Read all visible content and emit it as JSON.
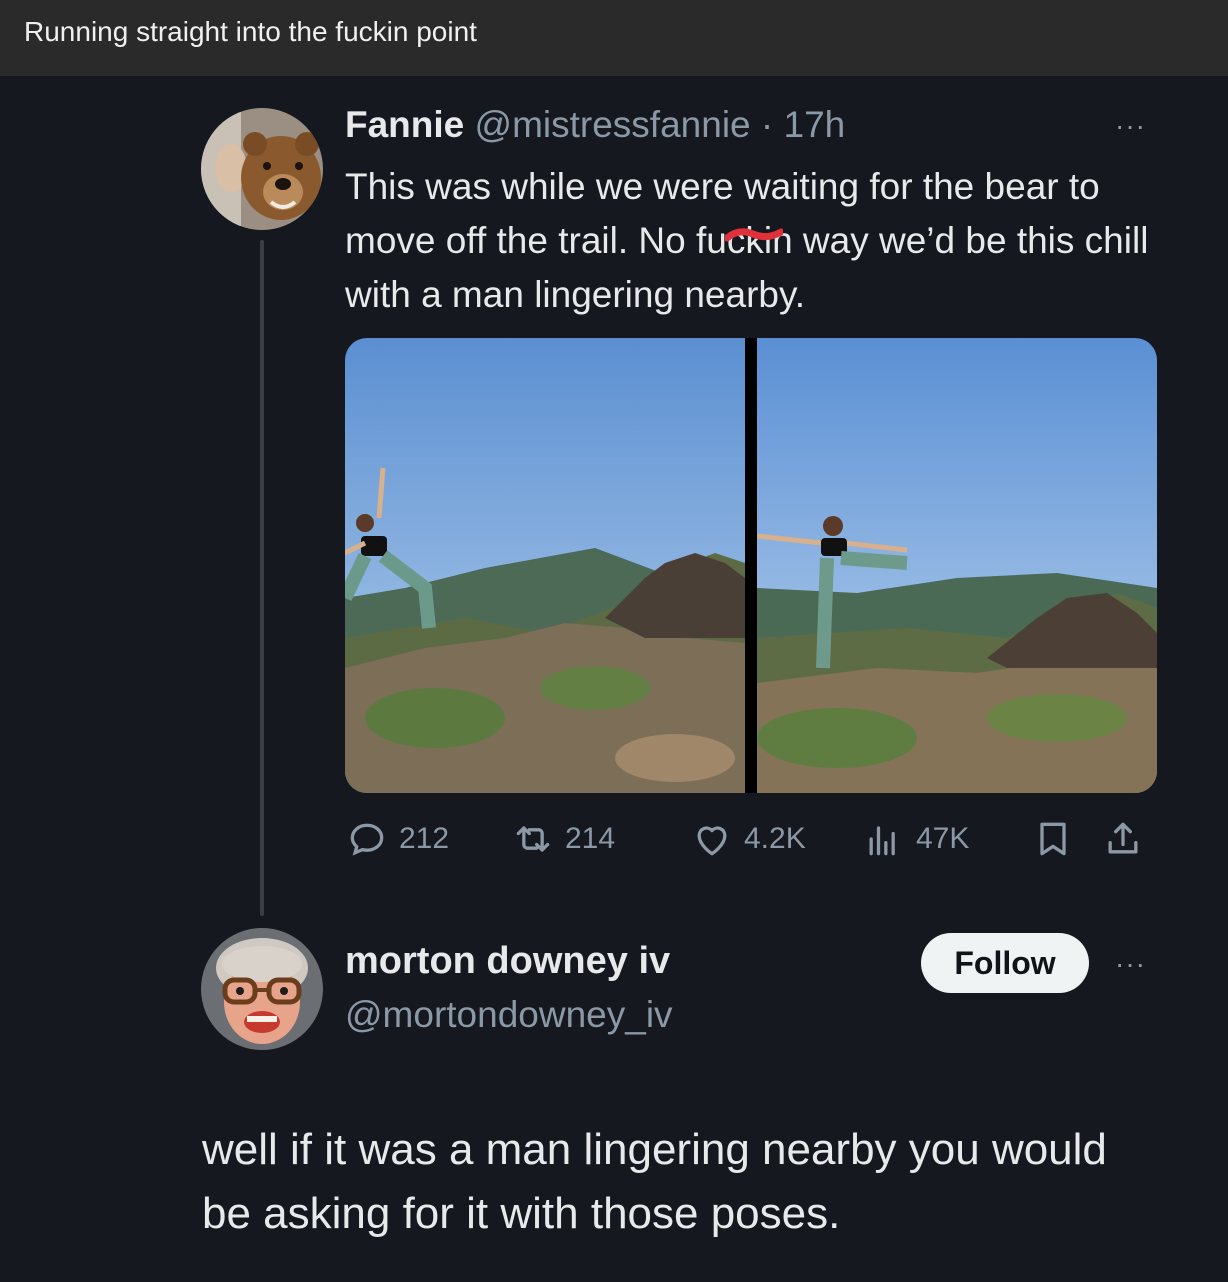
{
  "caption": "Running straight into the fuckin point",
  "tweet": {
    "display_name": "Fannie",
    "handle": "@mistressfannie",
    "time": "· 17h",
    "more": "···",
    "body_before": "This was while we were waiting for the bear to move off the trail. No fu",
    "body_redacted": "ckin",
    "body_after": " way we’d be this chill with a man lingering nearby.",
    "stats": {
      "replies": "212",
      "retweets": "214",
      "likes": "4.2K",
      "views": "47K"
    }
  },
  "reply": {
    "display_name": "morton downey iv",
    "handle": "@mortondowney_iv",
    "follow_label": "Follow",
    "more": "···",
    "body": "well if it was a man lingering nearby you would be asking for it with those poses."
  },
  "colors": {
    "background": "#15181f",
    "caption_bar": "#2a2a2a",
    "text": "#e7e9ea",
    "muted": "#8b98a5",
    "redaction": "#e0303a"
  }
}
